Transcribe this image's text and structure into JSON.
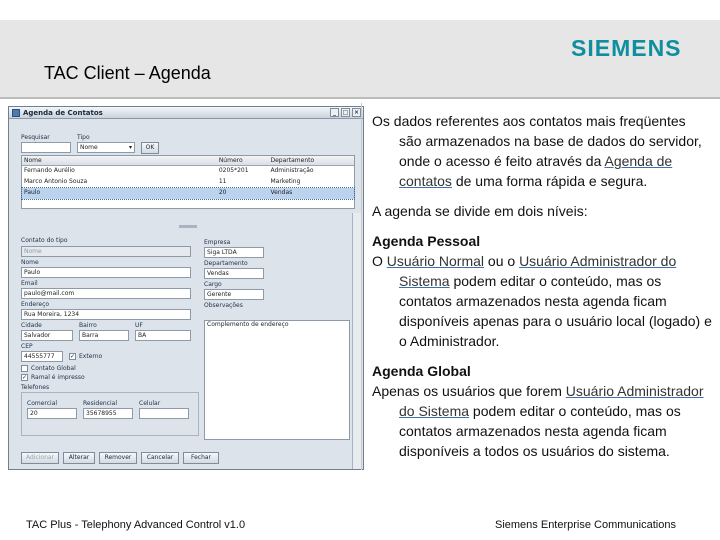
{
  "slide": {
    "title": "TAC Client – Agenda",
    "logo": "SIEMENS",
    "footer_left": "TAC Plus - Telephony Advanced Control v1.0",
    "footer_right": "Siemens Enterprise Communications"
  },
  "window": {
    "title": "Agenda de Contatos",
    "search_label": "Pesquisar",
    "type_label": "Tipo",
    "type_value": "Nome",
    "ok_label": "OK",
    "columns": [
      "Nome",
      "Número",
      "Departamento"
    ],
    "rows": [
      [
        "Fernando Aurélio",
        "0205*201",
        "Administração"
      ],
      [
        "Marco Antonio Souza",
        "11",
        "Marketing"
      ],
      [
        "Paulo",
        "20",
        "Vendas"
      ]
    ],
    "form": {
      "contact_type_label": "Contato do tipo",
      "contact_type_value": "Nome",
      "name_label": "Nome",
      "name_value": "Paulo",
      "email_label": "Email",
      "email_value": "paulo@mail.com",
      "address_label": "Endereço",
      "address_value": "Rua Moreira, 1234",
      "city_label": "Cidade",
      "city_value": "Salvador",
      "district_label": "Bairro",
      "district_value": "Barra",
      "state_label": "UF",
      "state_value": "BA",
      "cep_label": "CEP",
      "cep_value": "44555777",
      "company_label": "Empresa",
      "company_value": "Siga LTDA",
      "department_label": "Departamento",
      "department_value": "Vendas",
      "role_label": "Cargo",
      "role_value": "Gerente",
      "notes_label": "Observações",
      "notes_value": "Complemento de endereço",
      "global_contact_label": "Contato Global",
      "ramal_label": "Ramal",
      "ramal_label2": "Ramal é impresso",
      "external_label": "Externo",
      "phones_label": "Telefones",
      "commercial_label": "Comercial",
      "commercial_value": "20",
      "residential_label": "Residencial",
      "residential_value": "35678955",
      "mobile_label": "Celular",
      "mobile_value": ""
    },
    "buttons": [
      "Adicionar",
      "Alterar",
      "Remover",
      "Cancelar",
      "Fechar"
    ]
  },
  "content": {
    "p1_pre": "Os dados referentes aos contatos mais freqüentes são armazenados na base de dados do servidor, onde o acesso é feito através da ",
    "p1_link": "Agenda de contatos",
    "p1_post": " de uma forma rápida e segura.",
    "p2": "A agenda se divide em dois níveis:",
    "h1": "Agenda Pessoal",
    "p3_pre": "O ",
    "p3_link1": "Usuário Normal",
    "p3_mid": " ou o ",
    "p3_link2": "Usuário Administrador do Sistema",
    "p3_post": " podem editar o conteúdo, mas os contatos armazenados nesta agenda ficam disponíveis apenas para o usuário local (logado) e o Administrador.",
    "h2": "Agenda Global",
    "p4_pre": "Apenas os usuários que forem ",
    "p4_link": "Usuário Administrador do Sistema",
    "p4_post": " podem editar o conteúdo, mas os contatos armazenados nesta agenda ficam disponíveis a todos os usuários do sistema."
  }
}
